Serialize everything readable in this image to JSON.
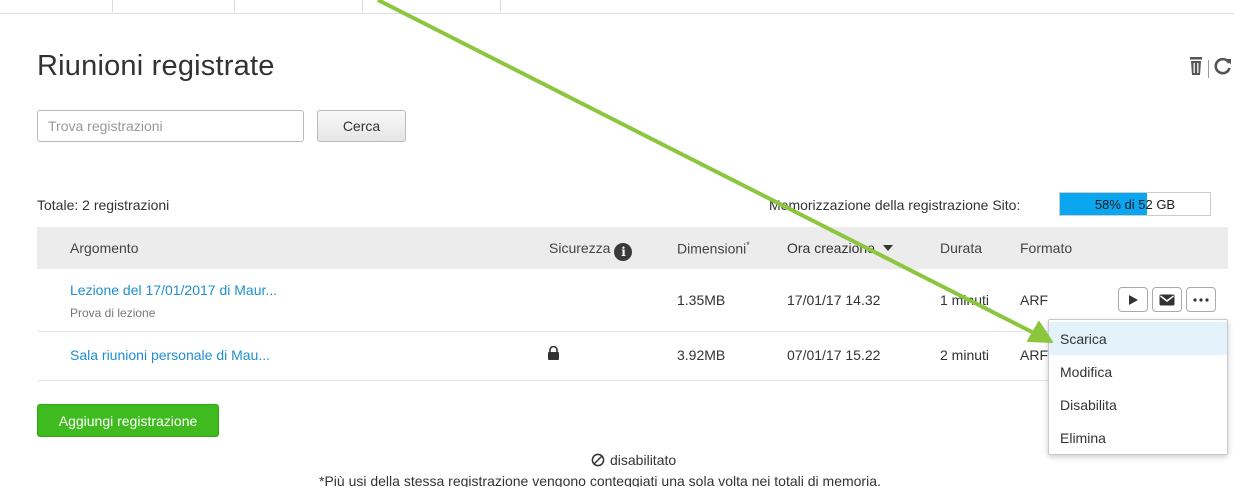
{
  "page": {
    "title": "Riunioni registrate"
  },
  "search": {
    "placeholder": "Trova registrazioni",
    "value": "",
    "button_label": "Cerca"
  },
  "summary": {
    "total_label": "Totale: 2 registrazioni",
    "storage_label": "Memorizzazione della registrazione Sito:",
    "storage_percent": 58,
    "storage_text": "58% di 52 GB",
    "storage_color": "#0aa6f0"
  },
  "table": {
    "headers": {
      "topic": "Argomento",
      "security": "Sicurezza",
      "size": "Dimensioni",
      "size_mark": "*",
      "created": "Ora creazione",
      "duration": "Durata",
      "format": "Formato"
    },
    "rows": [
      {
        "topic": "Lezione del 17/01/2017 di Maur...",
        "subtitle": "Prova di lezione",
        "security": "",
        "size": "1.35MB",
        "created": "17/01/17 14.32",
        "duration": "1 minuti",
        "format": "ARF"
      },
      {
        "topic": "Sala riunioni personale di Mau...",
        "subtitle": "",
        "security": "lock-icon",
        "size": "3.92MB",
        "created": "07/01/17 15.22",
        "duration": "2 minuti",
        "format": "ARF"
      }
    ]
  },
  "actions": {
    "icons": [
      "play-icon",
      "mail-icon",
      "more-icon"
    ]
  },
  "menu": {
    "items": [
      "Scarica",
      "Modifica",
      "Disabilita",
      "Elimina"
    ],
    "highlighted": "Scarica"
  },
  "add_button": {
    "label": "Aggiungi registrazione",
    "color": "#3fbb1f"
  },
  "legend": {
    "icon": "disabled-icon",
    "text": "disabilitato"
  },
  "footnote": "*Più usi della stessa registrazione vengono conteggiati una sola volta nei totali di memoria.",
  "colors": {
    "link": "#1f8fd0",
    "header_bg": "#ececec",
    "menu_highlight": "#e3f2fb",
    "annotation_arrow": "#8cc63f"
  },
  "icons": {
    "top_right": [
      "trash-icon",
      "refresh-icon"
    ]
  }
}
